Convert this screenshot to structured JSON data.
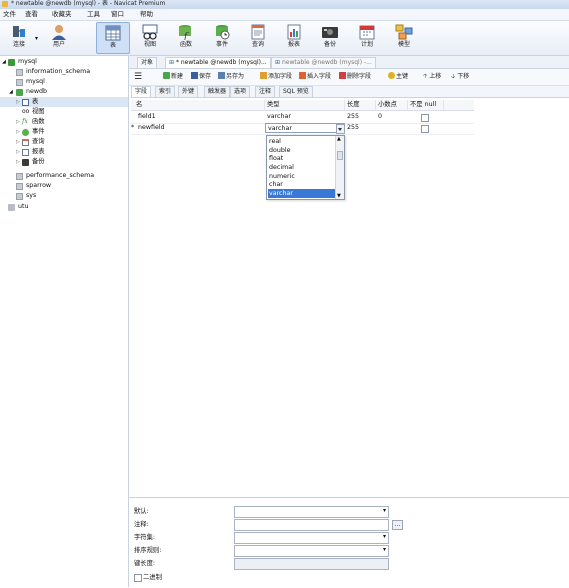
{
  "window": {
    "title": "* newtable @newdb (mysql) - 表 - Navicat Premium"
  },
  "menu": [
    "文件",
    "查看",
    "收藏夹",
    "工具",
    "窗口",
    "帮助"
  ],
  "toolbar": {
    "items": [
      {
        "label": "连接",
        "icon": "connection-icon"
      },
      {
        "label": "用户",
        "icon": "user-icon"
      },
      {
        "label": "表",
        "icon": "table-icon",
        "selected": true
      },
      {
        "label": "视图",
        "icon": "view-icon"
      },
      {
        "label": "函数",
        "icon": "function-icon"
      },
      {
        "label": "事件",
        "icon": "event-icon"
      },
      {
        "label": "查询",
        "icon": "query-icon"
      },
      {
        "label": "报表",
        "icon": "report-icon"
      },
      {
        "label": "备份",
        "icon": "backup-icon"
      },
      {
        "label": "计划",
        "icon": "schedule-icon"
      },
      {
        "label": "模型",
        "icon": "model-icon"
      }
    ]
  },
  "sidebar": {
    "tree": [
      {
        "label": "mysql",
        "icon": "connection-icon"
      },
      {
        "label": "information_schema",
        "icon": "database-icon"
      },
      {
        "label": "mysql",
        "icon": "database-icon"
      },
      {
        "label": "newdb",
        "icon": "database-open-icon"
      },
      {
        "label": "表",
        "icon": "table-icon"
      },
      {
        "label": "视图",
        "icon": "view-icon"
      },
      {
        "label": "函数",
        "icon": "function-icon"
      },
      {
        "label": "事件",
        "icon": "event-icon"
      },
      {
        "label": "查询",
        "icon": "query-icon"
      },
      {
        "label": "报表",
        "icon": "report-icon"
      },
      {
        "label": "备份",
        "icon": "backup-icon"
      },
      {
        "label": "performance_schema",
        "icon": "database-icon"
      },
      {
        "label": "sparrow",
        "icon": "database-icon"
      },
      {
        "label": "sys",
        "icon": "database-icon"
      },
      {
        "label": "utu",
        "icon": "connection-icon"
      }
    ]
  },
  "tabs": [
    {
      "label": "对象"
    },
    {
      "label": "* newtable @newdb (mysql)..."
    },
    {
      "label": "newtable @newdb (mysql) -..."
    }
  ],
  "subtoolbar": {
    "menu_icon": "hamburger-icon",
    "items": [
      {
        "label": "新建",
        "icon": "new-icon"
      },
      {
        "label": "保存",
        "icon": "save-icon"
      },
      {
        "label": "另存为",
        "icon": "save-as-icon"
      },
      {
        "label": "添加字段",
        "icon": "add-field-icon"
      },
      {
        "label": "插入字段",
        "icon": "insert-field-icon"
      },
      {
        "label": "删除字段",
        "icon": "delete-field-icon"
      },
      {
        "label": "主键",
        "icon": "key-icon"
      },
      {
        "label": "上移",
        "icon": "up-arrow-icon"
      },
      {
        "label": "下移",
        "icon": "down-arrow-icon"
      }
    ]
  },
  "subtabs": [
    "字段",
    "索引",
    "外键",
    "触发器",
    "选项",
    "注释",
    "SQL 预览"
  ],
  "grid": {
    "columns": [
      "名",
      "类型",
      "长度",
      "小数点",
      "不是 null"
    ],
    "rows": [
      {
        "name": "field1",
        "type": "varchar",
        "length": "255",
        "decimals": "0",
        "marker": ""
      },
      {
        "name": "newfield",
        "type": "varchar",
        "length": "255",
        "decimals": "",
        "marker": "*"
      }
    ]
  },
  "dropdown": {
    "items": [
      "real",
      "double",
      "float",
      "decimal",
      "numeric",
      "char",
      "varchar"
    ],
    "selected": "varchar"
  },
  "properties": {
    "default_label": "默认:",
    "comment_label": "注释:",
    "comment_button": "...",
    "charset_label": "字符集:",
    "collation_label": "排序规则:",
    "keylength_label": "键长度:",
    "binary_label": "二进制"
  },
  "colors": {
    "selection": "#3a78d6",
    "toolbar_selected": "#cfe0f6"
  }
}
